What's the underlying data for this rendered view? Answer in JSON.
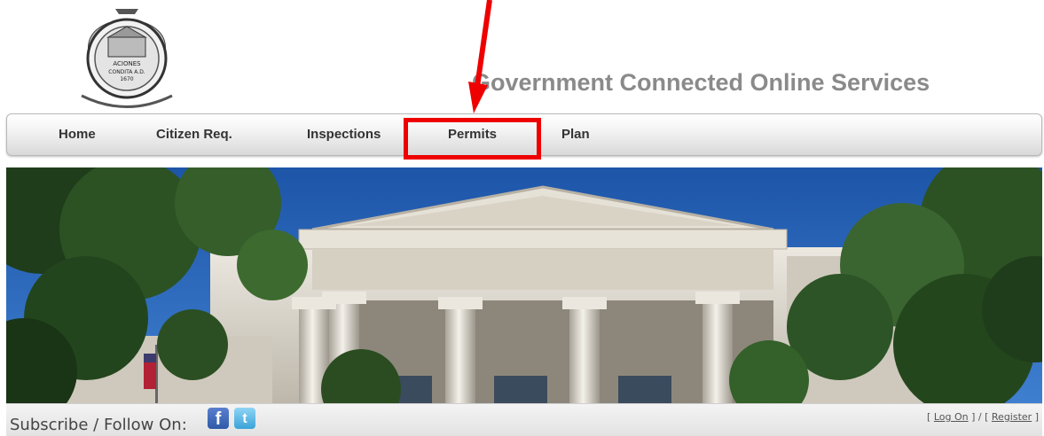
{
  "header": {
    "title": "Government Connected Online Services",
    "seal_text": [
      "ACIONES",
      "CONDITA A.D.",
      "1670"
    ]
  },
  "nav": {
    "items": [
      {
        "label": "Home"
      },
      {
        "label": "Citizen Req."
      },
      {
        "label": "Inspections"
      },
      {
        "label": "Permits"
      },
      {
        "label": "Plan"
      }
    ],
    "highlighted": "Permits"
  },
  "footer": {
    "follow_label": "Subscribe / Follow On:",
    "facebook_glyph": "f",
    "twitter_glyph": "t",
    "log_on": "Log On",
    "register": "Register",
    "sep_open": "[ ",
    "sep_mid": " ] / [ ",
    "sep_close": " ]"
  },
  "colors": {
    "annotation": "#ee0000",
    "title": "#8a8a8a",
    "sky": "#1f5aa6"
  }
}
